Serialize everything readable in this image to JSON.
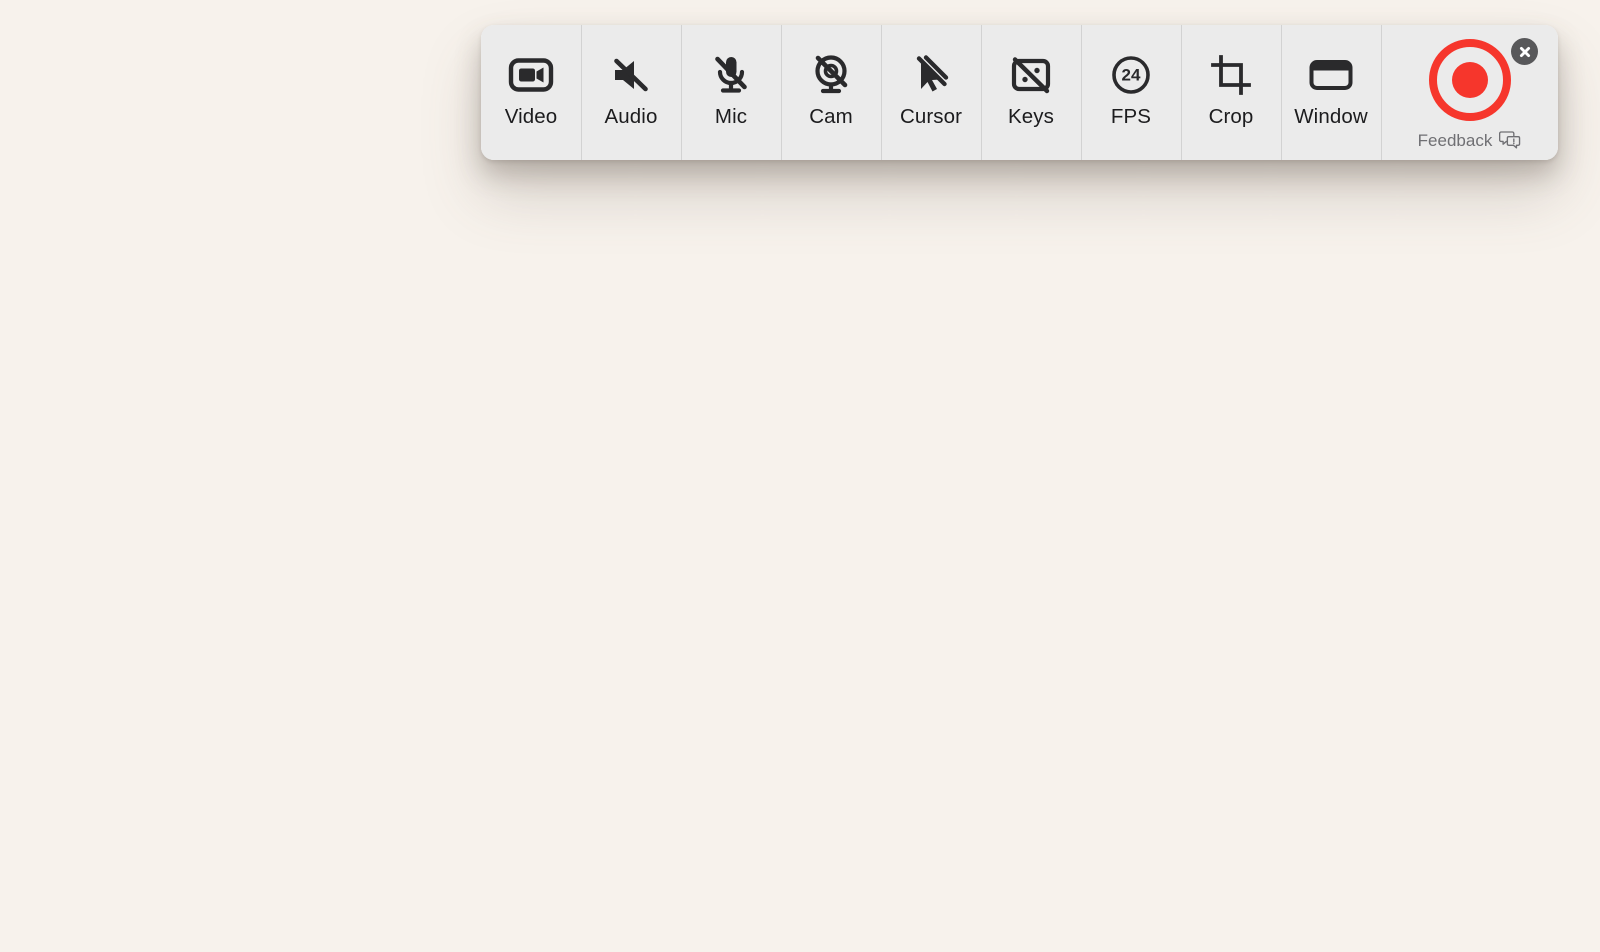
{
  "app": {
    "background_color": "#f7f2ec",
    "toolbar_color": "#ebebeb",
    "accent_color": "#f6362c",
    "divider_color": "#d2d2d2",
    "label_color": "#1c1c1e",
    "muted_label_color": "#6f6f73"
  },
  "toolbar": {
    "items": [
      {
        "label": "Video",
        "icon": "video-camera-icon",
        "state": "enabled"
      },
      {
        "label": "Audio",
        "icon": "speaker-muted-icon",
        "state": "muted"
      },
      {
        "label": "Mic",
        "icon": "microphone-muted-icon",
        "state": "muted"
      },
      {
        "label": "Cam",
        "icon": "webcam-off-icon",
        "state": "off"
      },
      {
        "label": "Cursor",
        "icon": "cursor-off-icon",
        "state": "off"
      },
      {
        "label": "Keys",
        "icon": "keystrokes-off-icon",
        "state": "off"
      },
      {
        "label": "FPS",
        "icon": "fps-circle-icon",
        "state": "enabled",
        "value": "24"
      },
      {
        "label": "Crop",
        "icon": "crop-icon",
        "state": "enabled"
      },
      {
        "label": "Window",
        "icon": "window-icon",
        "state": "enabled"
      }
    ]
  },
  "record": {
    "button_name": "record-button",
    "feedback_label": "Feedback",
    "feedback_icon": "feedback-bubble-icon"
  },
  "close": {
    "icon": "close-icon"
  }
}
